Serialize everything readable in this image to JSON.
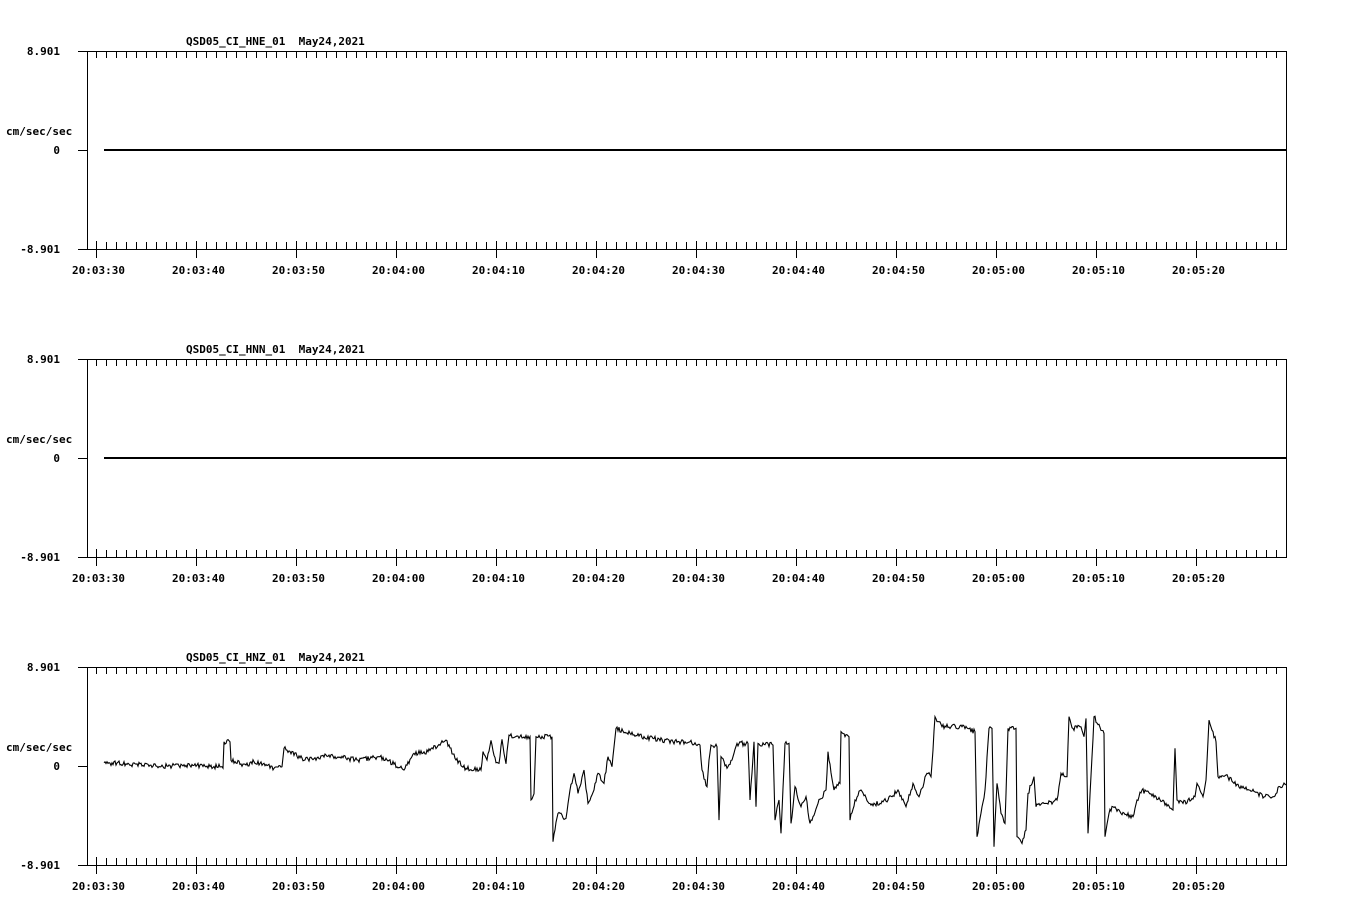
{
  "colors": {
    "background": "#ffffff",
    "trace": "#000000",
    "axis": "#000000"
  },
  "chart_data": [
    {
      "type": "line",
      "title": "QSD05_CI_HNE_01  May24,2021",
      "ylabel": "cm/sec/sec",
      "ylim": [
        -8.901,
        8.901
      ],
      "ytick_labels": [
        "8.901",
        "0",
        "-8.901"
      ],
      "xlim_seconds_from_first_tick": [
        -0.9,
        119.0
      ],
      "xtick_labels": [
        "20:03:30",
        "20:03:40",
        "20:03:50",
        "20:04:00",
        "20:04:10",
        "20:04:20",
        "20:04:30",
        "20:04:40",
        "20:04:50",
        "20:05:00",
        "20:05:10",
        "20:05:20"
      ],
      "series": [
        {
          "name": "HNE",
          "points": [
            [
              0.8,
              0
            ],
            [
              119.0,
              0
            ]
          ]
        }
      ]
    },
    {
      "type": "line",
      "title": "QSD05_CI_HNN_01  May24,2021",
      "ylabel": "cm/sec/sec",
      "ylim": [
        -8.901,
        8.901
      ],
      "ytick_labels": [
        "8.901",
        "0",
        "-8.901"
      ],
      "xlim_seconds_from_first_tick": [
        -0.9,
        119.0
      ],
      "xtick_labels": [
        "20:03:30",
        "20:03:40",
        "20:03:50",
        "20:04:00",
        "20:04:10",
        "20:04:20",
        "20:04:30",
        "20:04:40",
        "20:04:50",
        "20:05:00",
        "20:05:10",
        "20:05:20"
      ],
      "series": [
        {
          "name": "HNN",
          "points": [
            [
              0.8,
              0
            ],
            [
              119.0,
              0
            ]
          ]
        }
      ]
    },
    {
      "type": "line",
      "title": "QSD05_CI_HNZ_01  May24,2021",
      "ylabel": "cm/sec/sec",
      "ylim": [
        -8.901,
        8.901
      ],
      "ytick_labels": [
        "8.901",
        "0",
        "-8.901"
      ],
      "xlim_seconds_from_first_tick": [
        -0.9,
        119.0
      ],
      "xtick_labels": [
        "20:03:30",
        "20:03:40",
        "20:03:50",
        "20:04:00",
        "20:04:10",
        "20:04:20",
        "20:04:30",
        "20:04:40",
        "20:04:50",
        "20:05:00",
        "20:05:10",
        "20:05:20"
      ],
      "series": [
        {
          "name": "HNZ",
          "points": [
            [
              0.8,
              0.3
            ],
            [
              3,
              0.2
            ],
            [
              6,
              0.0
            ],
            [
              9,
              0.05
            ],
            [
              12.6,
              -0.06
            ],
            [
              12.7,
              -0.2
            ],
            [
              12.8,
              2.18
            ],
            [
              13.4,
              2.18
            ],
            [
              13.5,
              0.5
            ],
            [
              15.0,
              0.09
            ],
            [
              15.8,
              0.39
            ],
            [
              17.8,
              -0.21
            ],
            [
              18.6,
              -0.06
            ],
            [
              18.8,
              1.59
            ],
            [
              20.9,
              0.54
            ],
            [
              23.3,
              0.99
            ],
            [
              26.1,
              0.54
            ],
            [
              28.4,
              0.84
            ],
            [
              30.8,
              -0.36
            ],
            [
              31.8,
              1.14
            ],
            [
              33.2,
              1.29
            ],
            [
              35.0,
              2.33
            ],
            [
              36.0,
              0.54
            ],
            [
              37.0,
              -0.21
            ],
            [
              38.5,
              -0.36
            ],
            [
              38.7,
              1.3
            ],
            [
              39.1,
              0.54
            ],
            [
              39.5,
              2.3
            ],
            [
              40.0,
              0.3
            ],
            [
              40.3,
              0.24
            ],
            [
              40.6,
              2.4
            ],
            [
              41.0,
              0.2
            ],
            [
              41.3,
              2.78
            ],
            [
              43.4,
              2.63
            ],
            [
              43.5,
              -3.06
            ],
            [
              43.8,
              -2.5
            ],
            [
              44.0,
              2.63
            ],
            [
              45.6,
              2.63
            ],
            [
              45.7,
              -6.81
            ],
            [
              46.2,
              -4.26
            ],
            [
              47.0,
              -4.71
            ],
            [
              47.4,
              -2.16
            ],
            [
              47.8,
              -0.66
            ],
            [
              48.2,
              -2.46
            ],
            [
              48.8,
              -0.36
            ],
            [
              49.2,
              -3.36
            ],
            [
              49.8,
              -2.16
            ],
            [
              50.2,
              -0.66
            ],
            [
              50.8,
              -1.56
            ],
            [
              51.2,
              0.84
            ],
            [
              51.6,
              -0.06
            ],
            [
              52.0,
              3.38
            ],
            [
              53.7,
              2.78
            ],
            [
              55.7,
              2.48
            ],
            [
              57.7,
              2.18
            ],
            [
              59.4,
              2.18
            ],
            [
              60.4,
              1.88
            ],
            [
              60.6,
              -0.36
            ],
            [
              61.1,
              -1.86
            ],
            [
              61.3,
              0.54
            ],
            [
              61.5,
              1.88
            ],
            [
              62.1,
              1.73
            ],
            [
              62.3,
              -4.86
            ],
            [
              62.5,
              0.84
            ],
            [
              63.1,
              -0.21
            ],
            [
              63.7,
              0.84
            ],
            [
              64.1,
              2.03
            ],
            [
              65.2,
              2.03
            ],
            [
              65.4,
              -3.06
            ],
            [
              65.8,
              2.18
            ],
            [
              66.0,
              -3.66
            ],
            [
              66.2,
              2.03
            ],
            [
              67.7,
              1.88
            ],
            [
              67.9,
              -4.86
            ],
            [
              68.3,
              -3.06
            ],
            [
              68.5,
              -6.06
            ],
            [
              68.9,
              2.03
            ],
            [
              69.3,
              2.03
            ],
            [
              69.5,
              -5.16
            ],
            [
              69.9,
              -1.86
            ],
            [
              70.5,
              -3.66
            ],
            [
              71.0,
              -2.76
            ],
            [
              71.4,
              -5.16
            ],
            [
              72.2,
              -3.36
            ],
            [
              73.0,
              -2.16
            ],
            [
              73.2,
              1.29
            ],
            [
              73.8,
              -2.16
            ],
            [
              74.4,
              -1.56
            ],
            [
              74.5,
              3.08
            ],
            [
              75.3,
              2.63
            ],
            [
              75.4,
              -4.86
            ],
            [
              75.9,
              -3.06
            ],
            [
              76.5,
              -2.16
            ],
            [
              77.3,
              -3.36
            ],
            [
              78.4,
              -3.36
            ],
            [
              79.6,
              -2.76
            ],
            [
              80.2,
              -2.16
            ],
            [
              81.0,
              -3.66
            ],
            [
              81.7,
              -1.56
            ],
            [
              82.3,
              -2.76
            ],
            [
              83.1,
              -0.66
            ],
            [
              83.5,
              -0.96
            ],
            [
              83.7,
              1.44
            ],
            [
              83.9,
              4.43
            ],
            [
              84.3,
              3.98
            ],
            [
              84.6,
              3.53
            ],
            [
              86.6,
              3.53
            ],
            [
              87.9,
              3.08
            ],
            [
              88.1,
              -6.36
            ],
            [
              88.9,
              -2.16
            ],
            [
              89.3,
              3.38
            ],
            [
              89.6,
              3.38
            ],
            [
              89.8,
              -7.26
            ],
            [
              90.1,
              -1.56
            ],
            [
              90.5,
              -4.26
            ],
            [
              90.9,
              -5.16
            ],
            [
              91.2,
              3.38
            ],
            [
              92.0,
              3.38
            ],
            [
              92.1,
              -6.36
            ],
            [
              92.6,
              -6.96
            ],
            [
              93.0,
              -5.76
            ],
            [
              93.2,
              -2.46
            ],
            [
              93.8,
              -0.96
            ],
            [
              94.0,
              -3.66
            ],
            [
              95.1,
              -3.36
            ],
            [
              96.1,
              -3.06
            ],
            [
              96.5,
              -0.66
            ],
            [
              97.1,
              -0.96
            ],
            [
              97.3,
              4.43
            ],
            [
              97.7,
              3.38
            ],
            [
              98.4,
              3.53
            ],
            [
              98.8,
              2.63
            ],
            [
              99.0,
              4.28
            ],
            [
              99.2,
              -6.06
            ],
            [
              99.6,
              0.84
            ],
            [
              99.8,
              4.43
            ],
            [
              100.8,
              2.93
            ],
            [
              100.9,
              -6.36
            ],
            [
              101.3,
              -4.26
            ],
            [
              101.7,
              -3.66
            ],
            [
              102.5,
              -4.26
            ],
            [
              103.7,
              -4.56
            ],
            [
              104.1,
              -3.06
            ],
            [
              104.6,
              -2.16
            ],
            [
              106.0,
              -2.76
            ],
            [
              107.0,
              -3.36
            ],
            [
              107.7,
              -3.96
            ],
            [
              107.9,
              1.59
            ],
            [
              108.1,
              -3.06
            ],
            [
              108.7,
              -3.36
            ],
            [
              109.9,
              -2.76
            ],
            [
              110.1,
              -1.56
            ],
            [
              110.7,
              -2.76
            ],
            [
              111.0,
              -1.26
            ],
            [
              111.3,
              4.13
            ],
            [
              111.6,
              3.23
            ],
            [
              112.0,
              2.18
            ],
            [
              112.2,
              -0.96
            ],
            [
              113.0,
              -0.81
            ],
            [
              113.8,
              -1.56
            ],
            [
              115.3,
              -2.16
            ],
            [
              116.9,
              -2.76
            ],
            [
              117.7,
              -2.76
            ],
            [
              118.4,
              -1.86
            ],
            [
              119.0,
              -1.71
            ]
          ]
        }
      ]
    }
  ]
}
